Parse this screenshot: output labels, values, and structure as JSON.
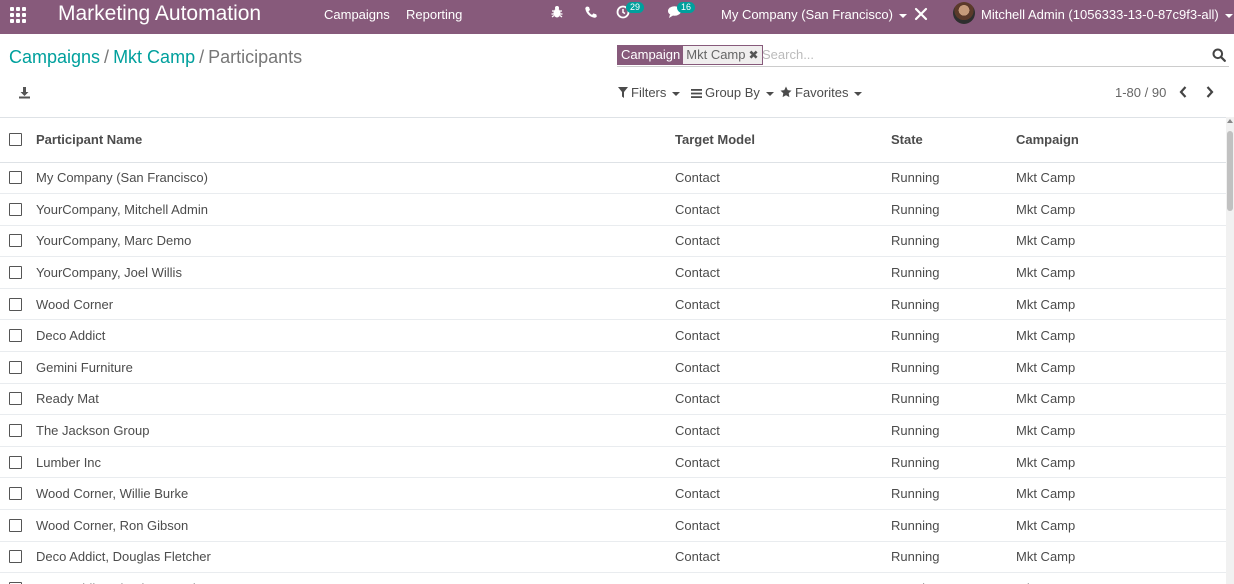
{
  "navbar": {
    "app_title": "Marketing Automation",
    "menu": [
      "Campaigns",
      "Reporting"
    ],
    "activity_count": "29",
    "message_count": "16",
    "company": "My Company (San Francisco)",
    "user": "Mitchell Admin (1056333-13-0-87c9f3-all)",
    "accent_color": "#875a7b"
  },
  "breadcrumb": {
    "items": [
      "Campaigns",
      "Mkt Camp"
    ],
    "separator": "/",
    "current": "Participants"
  },
  "search": {
    "facet_label": "Campaign",
    "facet_value": "Mkt Camp",
    "facet_remove": "✖",
    "placeholder": "Search..."
  },
  "controls": {
    "filters": "Filters",
    "group_by": "Group By",
    "favorites": "Favorites"
  },
  "pager": {
    "range": "1-80 / 90"
  },
  "table": {
    "columns": [
      "Participant Name",
      "Target Model",
      "State",
      "Campaign"
    ],
    "rows": [
      [
        "My Company (San Francisco)",
        "Contact",
        "Running",
        "Mkt Camp"
      ],
      [
        "YourCompany, Mitchell Admin",
        "Contact",
        "Running",
        "Mkt Camp"
      ],
      [
        "YourCompany, Marc Demo",
        "Contact",
        "Running",
        "Mkt Camp"
      ],
      [
        "YourCompany, Joel Willis",
        "Contact",
        "Running",
        "Mkt Camp"
      ],
      [
        "Wood Corner",
        "Contact",
        "Running",
        "Mkt Camp"
      ],
      [
        "Deco Addict",
        "Contact",
        "Running",
        "Mkt Camp"
      ],
      [
        "Gemini Furniture",
        "Contact",
        "Running",
        "Mkt Camp"
      ],
      [
        "Ready Mat",
        "Contact",
        "Running",
        "Mkt Camp"
      ],
      [
        "The Jackson Group",
        "Contact",
        "Running",
        "Mkt Camp"
      ],
      [
        "Lumber Inc",
        "Contact",
        "Running",
        "Mkt Camp"
      ],
      [
        "Wood Corner, Willie Burke",
        "Contact",
        "Running",
        "Mkt Camp"
      ],
      [
        "Wood Corner, Ron Gibson",
        "Contact",
        "Running",
        "Mkt Camp"
      ],
      [
        "Deco Addict, Douglas Fletcher",
        "Contact",
        "Running",
        "Mkt Camp"
      ],
      [
        "Deco Addict, Floyd Steward",
        "Contact",
        "Running",
        "Mkt Camp"
      ]
    ]
  }
}
